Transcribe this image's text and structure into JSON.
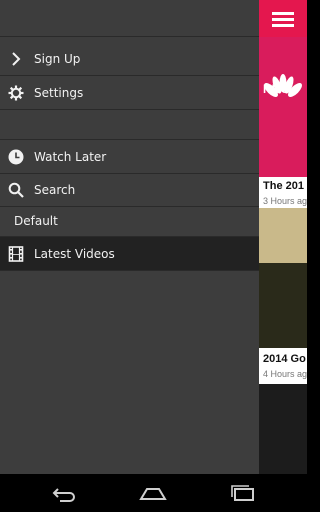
{
  "drawer": {
    "items": [
      {
        "label": "Sign Up",
        "icon": "chevron-right-icon"
      },
      {
        "label": "Settings",
        "icon": "gear-icon"
      },
      {
        "label": "Watch Later",
        "icon": "clock-icon"
      },
      {
        "label": "Search",
        "icon": "search-icon"
      }
    ],
    "section_label": "Default",
    "active_item": {
      "label": "Latest Videos",
      "icon": "film-icon"
    }
  },
  "content": {
    "logo_text": "NBC",
    "cards": [
      {
        "title": "The 201",
        "meta": "3 Hours ag"
      },
      {
        "title": "2014 Go",
        "meta": "4 Hours ag"
      }
    ]
  },
  "colors": {
    "drawer_bg": "#3d3d3d",
    "accent": "#e4174e"
  }
}
